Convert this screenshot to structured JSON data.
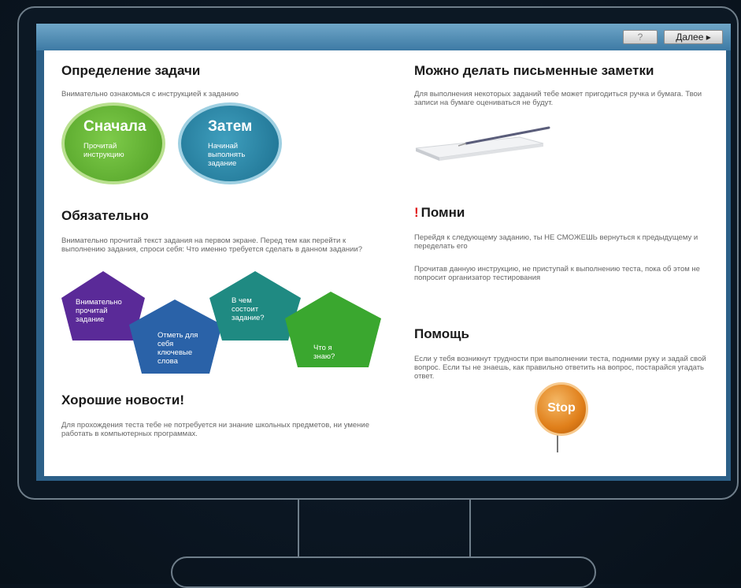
{
  "toolbar": {
    "help_label": "?",
    "next_label": "Далее ▸"
  },
  "left": {
    "task": {
      "title": "Определение задачи",
      "text": "Внимательно ознакомься с инструкцией к заданию",
      "first": {
        "title": "Сначала",
        "text": "Прочитай инструкцию"
      },
      "then": {
        "title": "Затем",
        "text": "Начинай выполнять задание"
      }
    },
    "required": {
      "title": "Обязательно",
      "text": "Внимательно прочитай текст задания на первом экране. Перед тем как перейти к выполнению задания, спроси себя: Что именно требуется сделать в данном задании?",
      "steps": [
        "Внимательно прочитай задание",
        "Отметь для себя ключевые слова",
        "В чем состоит задание?",
        "Что я знаю?"
      ]
    },
    "news": {
      "title": "Хорошие новости!",
      "text": "Для прохождения теста тебе не потребуется ни знание школьных предметов, ни умение работать в компьютерных программах."
    }
  },
  "right": {
    "notes": {
      "title": "Можно делать письменные заметки",
      "text": "Для выполнения некоторых заданий тебе может пригодиться ручка и бумага. Твои записи на бумаге оцениваться не будут."
    },
    "remember": {
      "mark": "!",
      "title": "Помни",
      "text1": "Перейдя к следующему заданию, ты НЕ СМОЖЕШЬ вернуться к предыдущему и переделать его",
      "text2": "Прочитав данную инструкцию, не приступай к выполнению теста, пока об этом не попросит организатор тестирования"
    },
    "help": {
      "title": "Помощь",
      "text": "Если у тебя возникнут трудности при выполнении теста, подними руку и задай свой вопрос. Если ты не знаешь, как правильно ответить на вопрос, постарайся угадать ответ.",
      "sign": "Stop"
    }
  },
  "colors": {
    "green": "#6aba3a",
    "teal": "#2f91ad",
    "purple": "#5a2a98",
    "blue": "#2a62a8",
    "tealdark": "#1f8a82",
    "green2": "#3aa72f",
    "orange": "#e07f1a"
  }
}
